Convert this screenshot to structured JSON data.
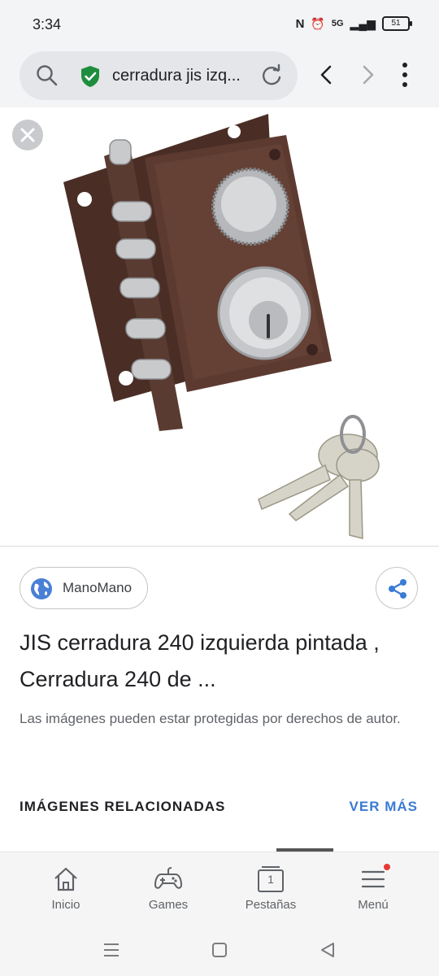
{
  "status_bar": {
    "time": "3:34",
    "network": "5G",
    "battery": "51"
  },
  "toolbar": {
    "url_text": "cerradura jis izq...",
    "secure_icon": "shield-check-icon",
    "accent": "#1e8e3e"
  },
  "image": {
    "subject": "lock-with-keys"
  },
  "source": {
    "name": "ManoMano"
  },
  "result": {
    "title": "JIS cerradura 240 izquierda pintada , Cerradura 240 de ...",
    "notice": "Las imágenes pueden estar protegidas por derechos de autor."
  },
  "related": {
    "heading": "IMÁGENES RELACIONADAS",
    "more_label": "VER MÁS",
    "link_color": "#3a7bd5"
  },
  "bottom_nav": {
    "items": [
      {
        "label": "Inicio",
        "icon": "home-icon"
      },
      {
        "label": "Games",
        "icon": "gamepad-icon"
      },
      {
        "label": "Pestañas",
        "icon": "tabs-icon",
        "count": "1"
      },
      {
        "label": "Menú",
        "icon": "menu-icon",
        "has_notification": true
      }
    ]
  }
}
